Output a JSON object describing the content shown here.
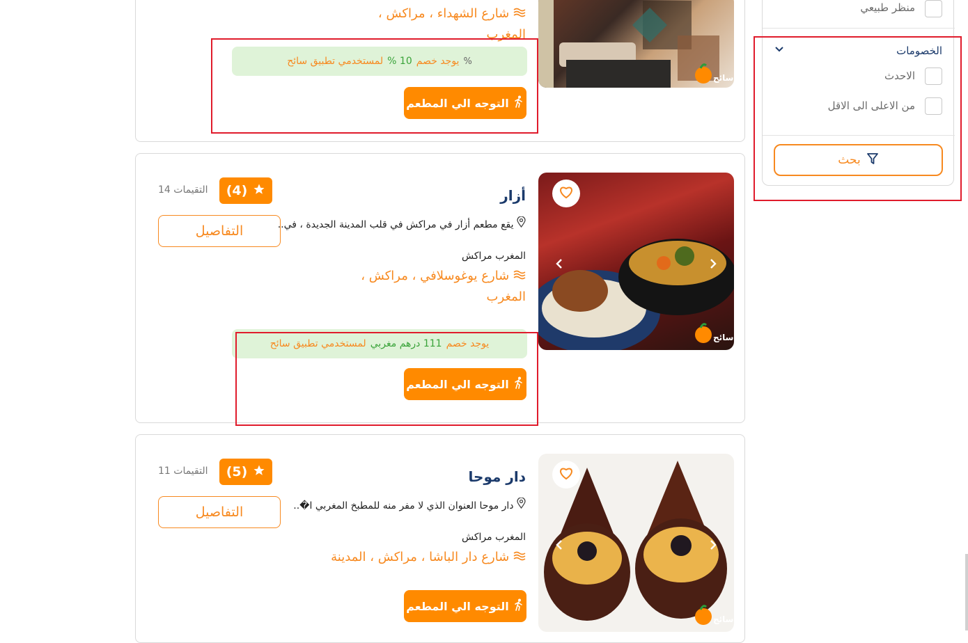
{
  "sidebar": {
    "filters": [
      {
        "label": "منظر طبيعي"
      }
    ],
    "discounts": {
      "title": "الخصومات",
      "options": [
        {
          "label": "الاحدث"
        },
        {
          "label": "من الاعلى الى الاقل"
        }
      ]
    },
    "search_label": "بحث"
  },
  "restaurants": [
    {
      "street": "شارع الشهداء ، مراكش ، المغرب",
      "discount_prefix": "يوجد خصم",
      "discount_value": "10 %",
      "discount_suffix": "لمستخدمي تطبيق سائح",
      "go_label": "التوجه الي المطعم"
    },
    {
      "name": "أزار",
      "rating": "(4)",
      "reviews": "14 التقيمات",
      "details_label": "التفاصيل",
      "description": "يقع مطعم أزار في مراكش في قلب المدينة الجديدة ، في..",
      "country_city": "المغرب مراكش",
      "street": "شارع يوغوسلافي ، مراكش ، المغرب",
      "discount_prefix": "يوجد خصم",
      "discount_value": "111 درهم مغربي",
      "discount_suffix": "لمستخدمي تطبيق سائح",
      "go_label": "التوجه الي المطعم"
    },
    {
      "name": "دار موحا",
      "rating": "(5)",
      "reviews": "11 التقيمات",
      "details_label": "التفاصيل",
      "description": "دار موحا العنوان الذي لا مفر منه للمطبخ المغربي ا�..",
      "country_city": "المغرب مراكش",
      "street": "شارع دار الباشا ، مراكش ، المدينة",
      "go_label": "التوجه الي المطعم"
    }
  ],
  "colors": {
    "accent": "#ff8a00",
    "title": "#1b3a6b",
    "discount_bg": "#dff3d8",
    "discount_green": "#3aa33a",
    "highlight_box": "#e01b2b"
  },
  "icons": [
    "pin-icon",
    "road-icon",
    "percent-icon",
    "walk-icon",
    "star-icon",
    "heart-icon",
    "chevron-left-icon",
    "chevron-right-icon",
    "funnel-icon",
    "chevron-down-icon"
  ]
}
